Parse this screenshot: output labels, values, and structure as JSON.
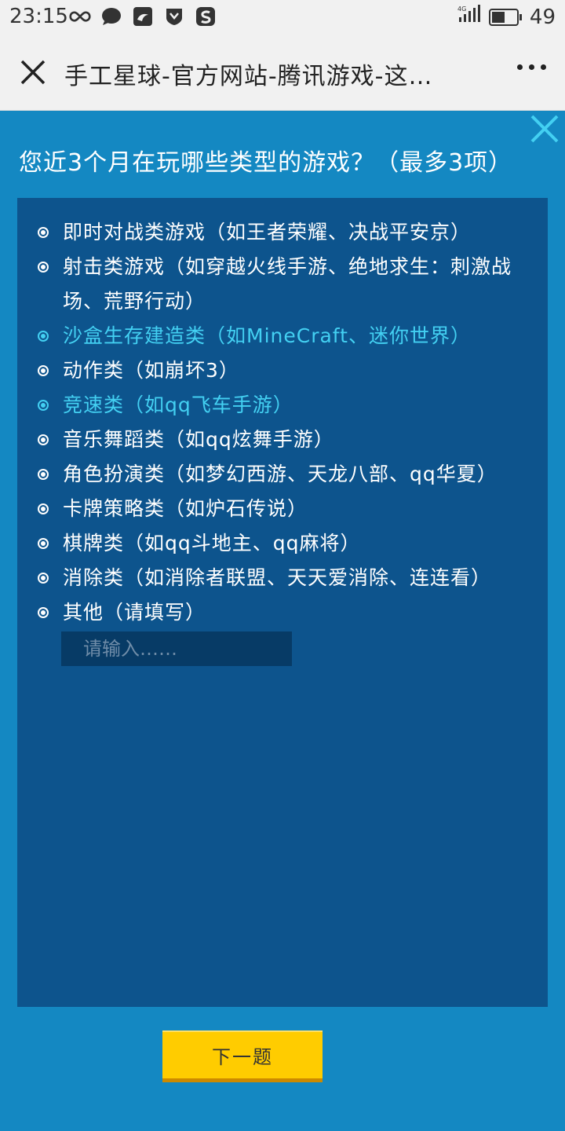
{
  "status": {
    "time": "23:15",
    "signal": "4G",
    "battery": "49"
  },
  "browser": {
    "title": "手工星球-官方网站-腾讯游戏-这…"
  },
  "survey": {
    "question": "您近3个月在玩哪些类型的游戏？（最多3项）",
    "options": [
      {
        "label": "即时对战类游戏（如王者荣耀、决战平安京）",
        "selected": false
      },
      {
        "label": "射击类游戏（如穿越火线手游、绝地求生：刺激战场、荒野行动）",
        "selected": false
      },
      {
        "label": "沙盒生存建造类（如MineCraft、迷你世界）",
        "selected": true
      },
      {
        "label": "动作类（如崩坏3）",
        "selected": false
      },
      {
        "label": "竞速类（如qq飞车手游）",
        "selected": true
      },
      {
        "label": "音乐舞蹈类（如qq炫舞手游）",
        "selected": false
      },
      {
        "label": "角色扮演类（如梦幻西游、天龙八部、qq华夏）",
        "selected": false
      },
      {
        "label": "卡牌策略类（如炉石传说）",
        "selected": false
      },
      {
        "label": "棋牌类（如qq斗地主、qq麻将）",
        "selected": false
      },
      {
        "label": "消除类（如消除者联盟、天天爱消除、连连看）",
        "selected": false
      },
      {
        "label": "其他（请填写）",
        "selected": false
      }
    ],
    "other_placeholder": "请输入……",
    "next_label": "下一题"
  },
  "colors": {
    "selected": "#43d0f2",
    "background": "#1488c2",
    "panel": "#0d548d",
    "button": "#ffcc00"
  }
}
